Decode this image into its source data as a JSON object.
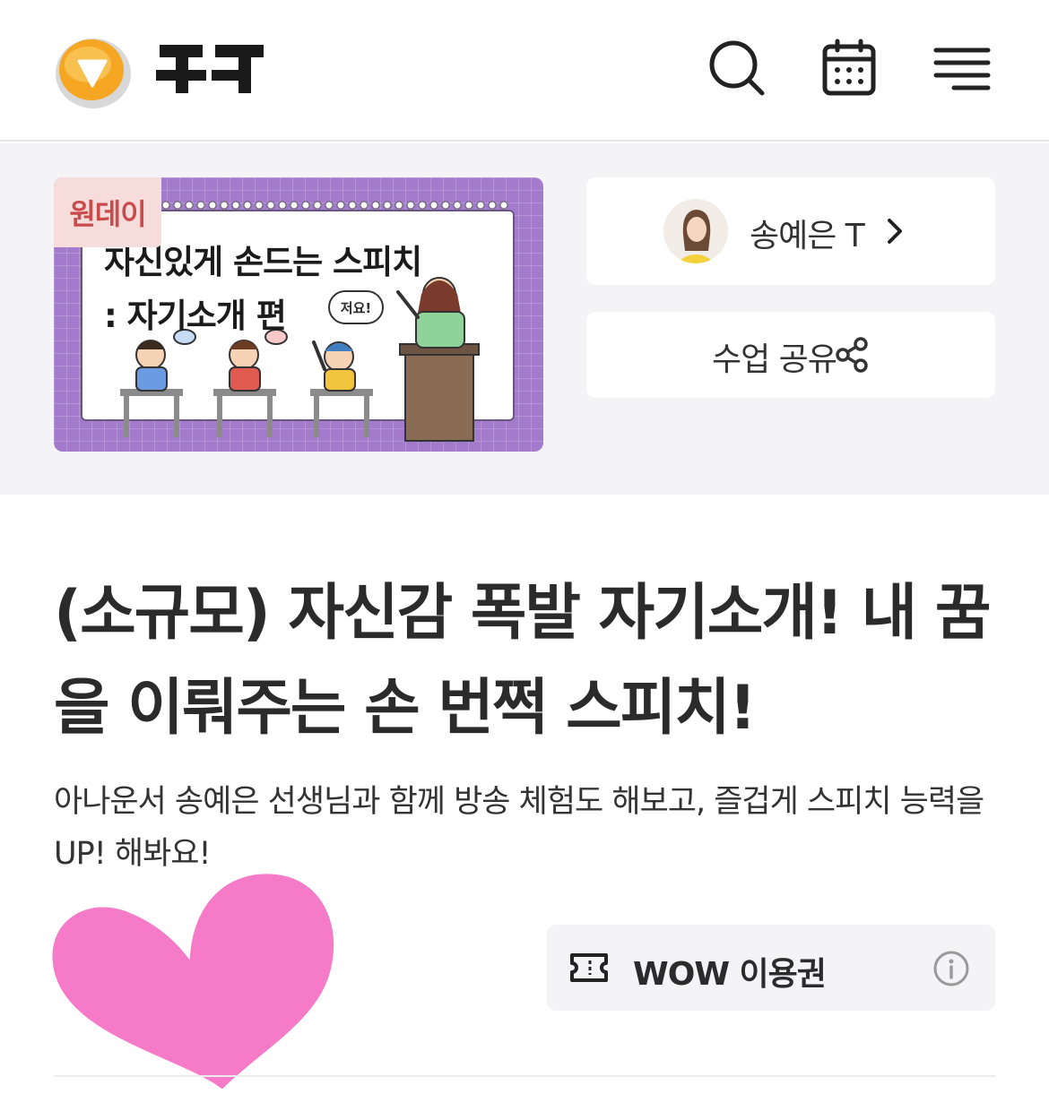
{
  "header": {
    "logo_text": "꾸그",
    "icons": [
      "search-icon",
      "calendar-icon",
      "menu-icon"
    ]
  },
  "thumbnail": {
    "badge": "원데이",
    "title_line1": "자신있게 손드는 스피치",
    "title_line2": ": 자기소개 편",
    "bubble": "저요!"
  },
  "teacher": {
    "name": "송예은 T"
  },
  "share": {
    "label": "수업 공유"
  },
  "course": {
    "title": "(소규모) 자신감 폭발 자기소개! 내 꿈을 이뤄주는 손 번쩍 스피치!",
    "description": "아나운서 송예은 선생님과 함께 방송 체험도 해보고, 즐겁게 스피치 능력을 UP! 해봐요!"
  },
  "ticket": {
    "label": "WOW 이용권"
  },
  "colors": {
    "accent": "#f5a623",
    "thumb_bg": "#a47acd",
    "badge_bg": "#f7dcdc",
    "badge_text": "#c94b4b",
    "heart": "#f57ac8",
    "panel_bg": "#f4f4f6"
  }
}
